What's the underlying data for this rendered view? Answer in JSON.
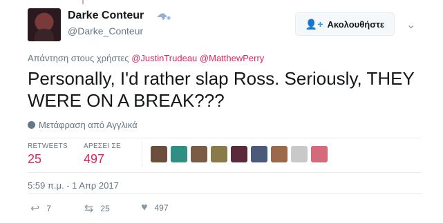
{
  "user": {
    "display_name": "Darke Conteur",
    "handle": "@Darke_Conteur"
  },
  "follow": {
    "label": "Ακολουθήστε"
  },
  "reply": {
    "prefix": "Απάντηση στους χρήστες",
    "mentions": [
      "@JustinTrudeau",
      "@MatthewPerry"
    ]
  },
  "tweet": {
    "text": "Personally, I'd rather slap Ross. Seriously, THEY WERE ON A BREAK???"
  },
  "translate": {
    "label": "Μετάφραση από Αγγλικά"
  },
  "stats": {
    "retweets_label": "RETWEETS",
    "retweets_value": "25",
    "likes_label": "ΑΡΕΣΕΙ ΣΕ",
    "likes_value": "497"
  },
  "likers": [
    {
      "name": "liker-1",
      "color": "#6b4e3d"
    },
    {
      "name": "liker-2",
      "color": "#2f8f83"
    },
    {
      "name": "liker-3",
      "color": "#7a5b45"
    },
    {
      "name": "liker-4",
      "color": "#8a7a4a"
    },
    {
      "name": "liker-5",
      "color": "#5a2a3a"
    },
    {
      "name": "liker-6",
      "color": "#4a5a7a"
    },
    {
      "name": "liker-7",
      "color": "#9a6a4a"
    },
    {
      "name": "liker-8",
      "color": "#c9c9c9"
    },
    {
      "name": "liker-9",
      "color": "#d46a7a"
    }
  ],
  "timestamp": "5:59 π.μ. - 1 Απρ 2017",
  "actions": {
    "reply_count": "7",
    "retweet_count": "25",
    "like_count": "497"
  },
  "colors": {
    "mention": "#e0245e",
    "count": "#e0245e",
    "follow_icon": "#1da1f2"
  }
}
